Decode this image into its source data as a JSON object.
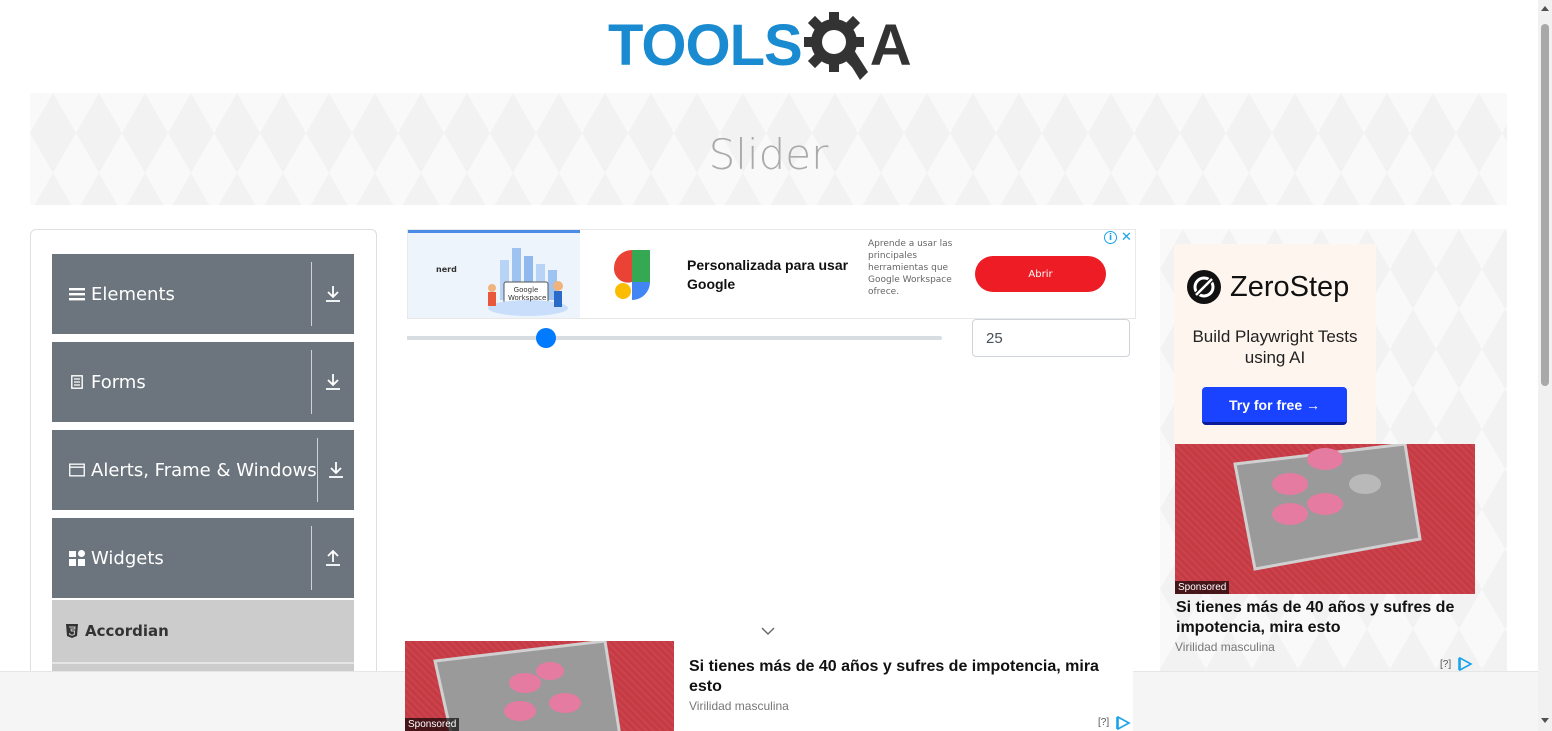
{
  "header": {
    "logo_text": "TOOLSQA",
    "logo_tools": "TOOLS",
    "logo_a": "A"
  },
  "banner": {
    "title": "Slider"
  },
  "menu": {
    "groups": [
      {
        "label": "Elements",
        "icon": "hamburger-icon",
        "toggle": "download-arrow-icon"
      },
      {
        "label": "Forms",
        "icon": "document-icon",
        "toggle": "download-arrow-icon"
      },
      {
        "label": "Alerts, Frame & Windows",
        "icon": "window-icon",
        "toggle": "download-arrow-icon"
      },
      {
        "label": "Widgets",
        "icon": "widgets-icon",
        "toggle": "upload-arrow-icon"
      }
    ],
    "items": [
      {
        "label": "Accordian",
        "icon": "html5-icon"
      }
    ]
  },
  "top_ad": {
    "headline": "Personalizada para usar Google",
    "description": "Aprende a usar las principales herramientas que Google Workspace ofrece.",
    "button": "Abrir",
    "thumb_brand": "nerd",
    "thumb_caption": "Google Workspace"
  },
  "slider": {
    "value": "25",
    "min": 0,
    "max": 100,
    "fraction": 0.26
  },
  "right_ad": {
    "brand": "ZeroStep",
    "tagline": "Build Playwright Tests using AI",
    "button": "Try for free →",
    "sponsored": "Sponsored",
    "title": "Si tienes más de 40 años y sufres de impotencia, mira esto",
    "source": "Virilidad masculina",
    "q": "[?]"
  },
  "bottom_ad": {
    "sponsored": "Sponsored",
    "title": "Si tienes más de 40 años y sufres de impotencia, mira esto",
    "source": "Virilidad masculina",
    "q": "[?]"
  },
  "colors": {
    "accent": "#007bff",
    "menu_bg": "#6c757d",
    "abrir": "#ee1c24",
    "zerostep_btn": "#1a43ff",
    "logo_blue": "#1a8bd0"
  }
}
